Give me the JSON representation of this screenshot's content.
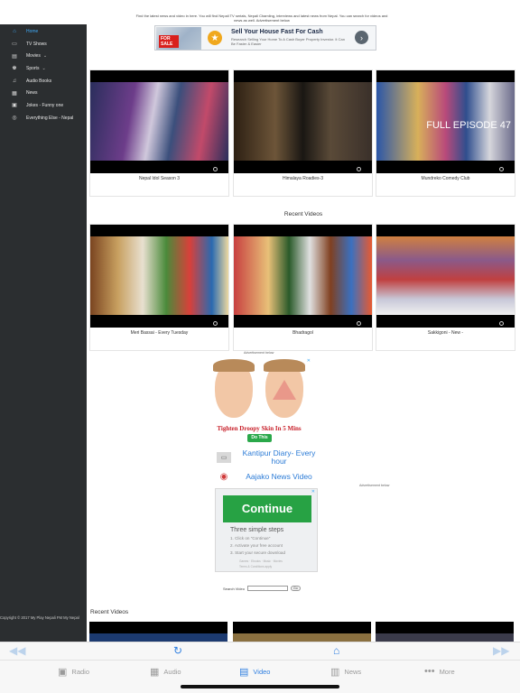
{
  "header": {
    "intro_text": "Find the latest news and video in here. You will find Nepali TV serials, Nepali Chamling, interviews and latest news from Nepal. You can search for videos and news as well.",
    "ad_label": "Advertisement below"
  },
  "top_ad": {
    "sale_label": "FOR SALE",
    "title": "Sell Your House Fast For Cash",
    "subtitle": "Research Selling Your Home To A Cash Buyer Property Investor. It Can Be Faster & Easier"
  },
  "sidebar": {
    "items": [
      {
        "label": "Home",
        "icon": "home-icon",
        "active": true
      },
      {
        "label": "TV Shows",
        "icon": "tv-icon"
      },
      {
        "label": "Movies",
        "icon": "film-icon",
        "caret": "⌄"
      },
      {
        "label": "Sports",
        "icon": "trophy-icon",
        "caret": "⌄"
      },
      {
        "label": "Audio Books",
        "icon": "music-icon"
      },
      {
        "label": "News",
        "icon": "newspaper-icon"
      },
      {
        "label": "Jokes - Funny one",
        "icon": "joke-icon"
      },
      {
        "label": "Everything Else - Nepal",
        "icon": "globe-icon"
      }
    ],
    "copyright": "Copyright © 2017 My Play Nepali FM My Nepal"
  },
  "featured_cards": [
    {
      "title": "Nepal Idol Season 3"
    },
    {
      "title": "Himalaya Roadies-3"
    },
    {
      "title": "Mundreko Comedy Club",
      "overlay": "FULL EPISODE 47"
    }
  ],
  "recent_section_title": "Recent Videos",
  "recent_cards": [
    {
      "title": "Meri Bassai - Every Tuesday"
    },
    {
      "title": "Bhadragol"
    },
    {
      "title": "Sakkigoni - New -"
    }
  ],
  "face_ad": {
    "ad_label": "Advertisement below",
    "headline": "Tighten Droopy Skin In 5 Mins",
    "button": "Do This"
  },
  "news_links": [
    {
      "label": "Kantipur Diary- Every hour"
    },
    {
      "label": "Aajako News Video"
    }
  ],
  "continue_ad": {
    "ad_label": "Advertisement below",
    "button": "Continue",
    "heading": "Three simple steps",
    "steps": [
      "1. Click on \"Continue\"",
      "2. Activate your free account",
      "3. Start your secure download"
    ],
    "fine_print": [
      "Games · Ebooks · Music · Movies",
      "Terms & Conditions apply"
    ]
  },
  "search": {
    "label": "Search Video",
    "button": "Go"
  },
  "recent_section_title_2": "Recent Videos",
  "tabbar": {
    "tabs": [
      {
        "label": "Radio",
        "icon": "radio-icon"
      },
      {
        "label": "Audio",
        "icon": "basket-icon"
      },
      {
        "label": "Video",
        "icon": "video-icon",
        "active": true
      },
      {
        "label": "News",
        "icon": "book-icon"
      },
      {
        "label": "More",
        "icon": "more-icon"
      }
    ]
  },
  "colors": {
    "sidebar_bg": "#2b2e30",
    "accent": "#2f7fe0",
    "link": "#2b7bd6",
    "ad_green": "#27a244"
  }
}
